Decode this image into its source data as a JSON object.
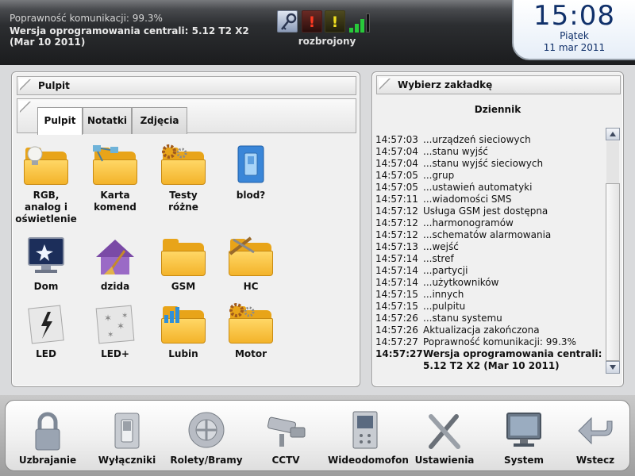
{
  "header": {
    "comm_status": "Poprawność komunikacji: 99.3%",
    "firmware_line1": "Wersja oprogramowania centrali: 5.12 T2 X2",
    "firmware_line2": "(Mar 10 2011)",
    "status_icons": [
      "key-icon",
      "alert-red-icon",
      "alert-yellow-icon",
      "signal-strength-icon"
    ],
    "alert_glyph": "!",
    "armed_status": "rozbrojony",
    "signal_colors": {
      "active": "#28c93a"
    }
  },
  "clock": {
    "time": "15:08",
    "day": "Piątek",
    "date": "11 mar 2011"
  },
  "left_panel": {
    "title": "Pulpit",
    "tabs": [
      {
        "label": "Pulpit",
        "active": true
      },
      {
        "label": "Notatki",
        "active": false
      },
      {
        "label": "Zdjęcia",
        "active": false
      }
    ],
    "items": [
      {
        "label": "RGB,\nanalog i\noświetlenie",
        "icon": "lightbulb-folder-icon"
      },
      {
        "label": "Karta\nkomend",
        "icon": "network-folder-icon"
      },
      {
        "label": "Testy\nróżne",
        "icon": "gears-folder-icon"
      },
      {
        "label": "blod?",
        "icon": "light-switch-icon"
      },
      {
        "label": "Dom",
        "icon": "monitor-icon"
      },
      {
        "label": "dzida",
        "icon": "house-broom-icon"
      },
      {
        "label": "GSM",
        "icon": "folder-icon"
      },
      {
        "label": "HC",
        "icon": "tools-folder-icon"
      },
      {
        "label": "LED",
        "icon": "led-flash-icon"
      },
      {
        "label": "LED+",
        "icon": "led-stars-icon"
      },
      {
        "label": "Lubin",
        "icon": "chart-folder-icon"
      },
      {
        "label": "Motor",
        "icon": "gears-folder-icon"
      }
    ]
  },
  "right_panel": {
    "title": "Wybierz zakładkę",
    "heading": "Dziennik",
    "log": [
      {
        "time": "14:57:03",
        "text": "...urządzeń sieciowych",
        "bold": false
      },
      {
        "time": "14:57:04",
        "text": "...stanu wyjść",
        "bold": false
      },
      {
        "time": "14:57:04",
        "text": "...stanu wyjść sieciowych",
        "bold": false
      },
      {
        "time": "14:57:05",
        "text": "...grup",
        "bold": false
      },
      {
        "time": "14:57:05",
        "text": "...ustawień automatyki",
        "bold": false
      },
      {
        "time": "14:57:11",
        "text": "...wiadomości SMS",
        "bold": false
      },
      {
        "time": "14:57:12",
        "text": "Usługa GSM jest dostępna",
        "bold": false
      },
      {
        "time": "14:57:12",
        "text": "...harmonogramów",
        "bold": false
      },
      {
        "time": "14:57:12",
        "text": "...schematów alarmowania",
        "bold": false
      },
      {
        "time": "14:57:13",
        "text": "...wejść",
        "bold": false
      },
      {
        "time": "14:57:14",
        "text": "...stref",
        "bold": false
      },
      {
        "time": "14:57:14",
        "text": "...partycji",
        "bold": false
      },
      {
        "time": "14:57:14",
        "text": "...użytkowników",
        "bold": false
      },
      {
        "time": "14:57:15",
        "text": "...innych",
        "bold": false
      },
      {
        "time": "14:57:15",
        "text": "...pulpitu",
        "bold": false
      },
      {
        "time": "14:57:26",
        "text": "...stanu systemu",
        "bold": false
      },
      {
        "time": "14:57:26",
        "text": "Aktualizacja zakończona",
        "bold": false
      },
      {
        "time": "14:57:27",
        "text": "Poprawność komunikacji: 99.3%",
        "bold": false
      },
      {
        "time": "14:57:27",
        "text": "Wersja oprogramowania centrali:",
        "text2": "5.12 T2 X2 (Mar 10 2011)",
        "bold": true
      }
    ]
  },
  "dock": [
    {
      "label": "Uzbrajanie",
      "icon": "padlock-icon"
    },
    {
      "label": "Wyłączniki",
      "icon": "switch-icon"
    },
    {
      "label": "Rolety/Bramy",
      "icon": "blinds-gate-icon"
    },
    {
      "label": "CCTV",
      "icon": "cctv-camera-icon"
    },
    {
      "label": "Wideodomofon",
      "icon": "video-intercom-icon"
    },
    {
      "label": "Ustawienia",
      "icon": "tools-icon"
    },
    {
      "label": "System",
      "icon": "monitor-icon"
    },
    {
      "label": "Wstecz",
      "icon": "back-arrow-icon"
    }
  ]
}
